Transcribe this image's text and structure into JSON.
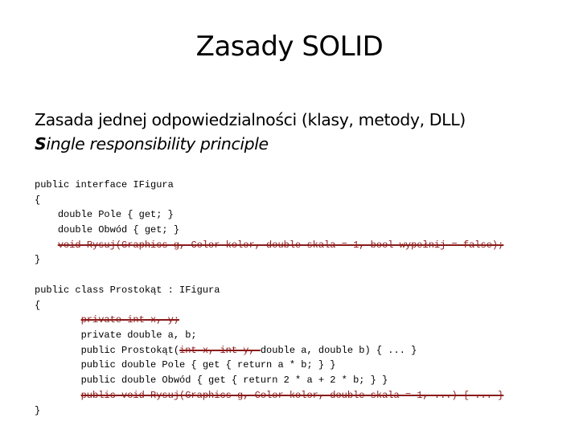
{
  "slide": {
    "title": "Zasady SOLID",
    "subtitle_pl": "Zasada jednej odpowiedzialności (klasy, metody, DLL)",
    "subtitle_en_first": "S",
    "subtitle_en_rest": "ingle responsibility principle"
  },
  "colors": {
    "strikethrough": "#8b1a1a"
  },
  "code_interface": [
    {
      "indent": "",
      "text": "public interface IFigura",
      "struck": "",
      "after": ""
    },
    {
      "indent": "",
      "text": "{",
      "struck": "",
      "after": ""
    },
    {
      "indent": "    ",
      "text": "double Pole { get; }",
      "struck": "",
      "after": ""
    },
    {
      "indent": "    ",
      "text": "double Obwód { get; }",
      "struck": "",
      "after": ""
    },
    {
      "indent": "    ",
      "text": "",
      "struck": "void Rysuj(Graphics g, Color kolor, double skala = 1, bool wypełnij = false);",
      "after": ""
    },
    {
      "indent": "",
      "text": "}",
      "struck": "",
      "after": ""
    }
  ],
  "code_class": [
    {
      "indent": "",
      "text": "public class Prostokąt : IFigura",
      "struck": "",
      "after": ""
    },
    {
      "indent": "",
      "text": "{",
      "struck": "",
      "after": ""
    },
    {
      "indent": "        ",
      "text": "",
      "struck": "private int x, y;",
      "after": ""
    },
    {
      "indent": "        ",
      "text": "private double a, b;",
      "struck": "",
      "after": ""
    },
    {
      "indent": "        ",
      "text": "public Prostokąt(",
      "struck": "int x, int y, ",
      "after": "double a, double b) { ... }"
    },
    {
      "indent": "        ",
      "text": "public double Pole { get { return a * b; } }",
      "struck": "",
      "after": ""
    },
    {
      "indent": "        ",
      "text": "public double Obwód { get { return 2 * a + 2 * b; } }",
      "struck": "",
      "after": ""
    },
    {
      "indent": "        ",
      "text": "",
      "struck": "public void Rysuj(Graphics g, Color kolor, double skala = 1, ...) { ... }",
      "after": ""
    },
    {
      "indent": "",
      "text": "}",
      "struck": "",
      "after": ""
    }
  ]
}
